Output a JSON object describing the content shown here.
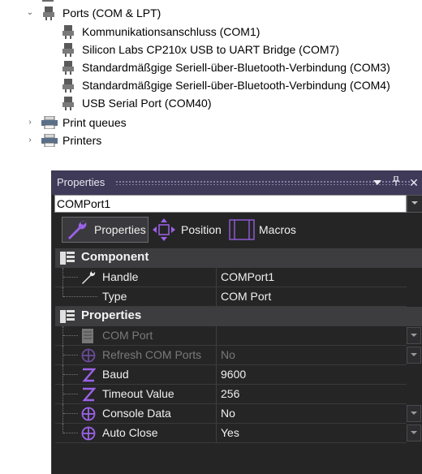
{
  "tree": {
    "ports_label": "Ports (COM & LPT)",
    "port_items": [
      "Kommunikationsanschluss (COM1)",
      "Silicon Labs CP210x USB to UART Bridge (COM7)",
      "Standardmäßgige Seriell-über-Bluetooth-Verbindung (COM3)",
      "Standardmäßgige Seriell-über-Bluetooth-Verbindung (COM4)",
      "USB Serial Port (COM40)"
    ],
    "print_queues_label": "Print queues",
    "printers_label": "Printers"
  },
  "panel": {
    "title": "Properties",
    "pin_glyph": "↕",
    "close_glyph": "✕",
    "object_selector_value": "COMPort1",
    "tabs": [
      "Properties",
      "Position",
      "Macros"
    ],
    "selected_tab": "Properties",
    "categories": {
      "component": {
        "label": "Component",
        "rows": [
          {
            "name": "Handle",
            "value": "COMPort1",
            "icon": "wrench-icon"
          },
          {
            "name": "Type",
            "value": "COM Port",
            "icon": "none"
          }
        ]
      },
      "properties": {
        "label": "Properties",
        "rows": [
          {
            "name": "COM Port",
            "value": "",
            "icon": "list-icon",
            "disabled": true,
            "dropdown": true
          },
          {
            "name": "Refresh COM Ports",
            "value": "No",
            "icon": "crosshair-icon",
            "disabled": true,
            "dropdown": true
          },
          {
            "name": "Baud",
            "value": "9600",
            "icon": "z-icon"
          },
          {
            "name": "Timeout Value",
            "value": "256",
            "icon": "z-icon"
          },
          {
            "name": "Console Data",
            "value": "No",
            "icon": "crosshair-icon",
            "dropdown": true
          },
          {
            "name": "Auto Close",
            "value": "Yes",
            "icon": "crosshair-icon",
            "dropdown": true
          }
        ]
      }
    },
    "colors": {
      "titlebar": "#403a59",
      "panel_bg": "#252526",
      "category_bg": "#3d3d40",
      "accent_purple": "#9b62e6"
    }
  }
}
